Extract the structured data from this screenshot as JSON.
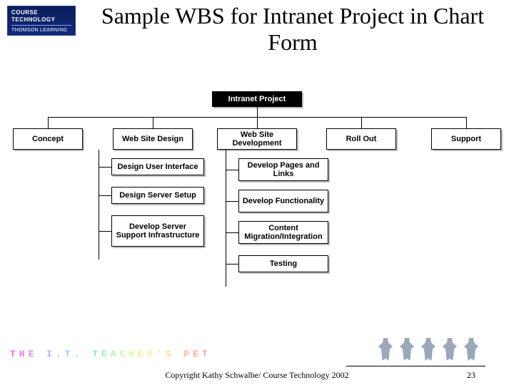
{
  "logo": {
    "line1": "COURSE",
    "line2": "TECHNOLOGY",
    "line3": "THOMSON LEARNING"
  },
  "title": "Sample WBS for Intranet Project in Chart Form",
  "wbs": {
    "root": "Intranet Project",
    "level1": {
      "n0": "Concept",
      "n1": "Web Site Design",
      "n2": "Web Site Development",
      "n3": "Roll Out",
      "n4": "Support"
    },
    "design_children": {
      "c0": "Design User Interface",
      "c1": "Design Server Setup",
      "c2": "Develop Server Support Infrastructure"
    },
    "dev_children": {
      "c0": "Develop Pages and Links",
      "c1": "Develop Functionality",
      "c2": "Content Migration/Integration",
      "c3": "Testing"
    }
  },
  "footer": {
    "brand": "THE I.T. TEACHER'S PET",
    "copyright": "Copyright Kathy Schwalbe/ Course Technology 2002",
    "page": "23"
  }
}
